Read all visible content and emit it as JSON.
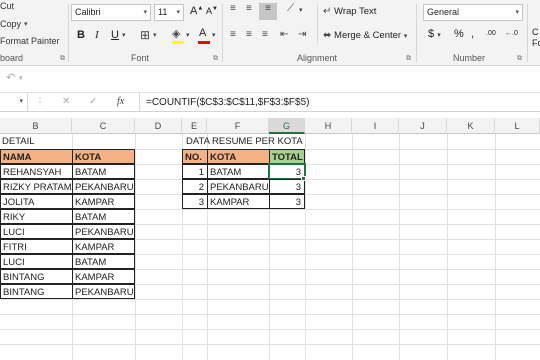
{
  "ribbon": {
    "clipboard": {
      "cut": "Cut",
      "copy": "Copy",
      "format_painter": "Format Painter",
      "label": "board"
    },
    "font": {
      "name": "Calibri",
      "size": "11",
      "grow": "A",
      "shrink": "A",
      "bold": "B",
      "italic": "I",
      "underline": "U",
      "font_color_letter": "A",
      "label": "Font"
    },
    "alignment": {
      "wrap_text": "Wrap Text",
      "merge_center": "Merge & Center",
      "label": "Alignment"
    },
    "number": {
      "format": "General",
      "currency": "$",
      "percent": "%",
      "comma": ",",
      "inc_decimals": ".00",
      "dec_decimals": "←.0",
      "label": "Number"
    },
    "styles": {
      "line1": "C",
      "line2": "Fo"
    }
  },
  "formula_bar": {
    "fx": "fx",
    "cancel": "✕",
    "enter": "✓",
    "formula": "=COUNTIF($C$3:$C$11,$F$3:$F$5)"
  },
  "columns": [
    "B",
    "C",
    "D",
    "E",
    "F",
    "G",
    "H",
    "I",
    "J",
    "K",
    "L"
  ],
  "selected_column": "G",
  "left_table": {
    "title": "DETAIL",
    "headers": [
      "NAMA",
      "KOTA"
    ],
    "rows": [
      [
        "REHANSYAH",
        "BATAM"
      ],
      [
        "RIZKY PRATAMA",
        "PEKANBARU"
      ],
      [
        "JOLITA",
        "KAMPAR"
      ],
      [
        "RIKY",
        "BATAM"
      ],
      [
        "LUCI",
        "PEKANBARU"
      ],
      [
        "FITRI",
        "KAMPAR"
      ],
      [
        "LUCI",
        "BATAM"
      ],
      [
        "BINTANG",
        "KAMPAR"
      ],
      [
        "BINTANG",
        "PEKANBARU"
      ]
    ]
  },
  "right_table": {
    "title": "DATA RESUME PER KOTA",
    "headers": [
      "NO.",
      "KOTA",
      "TOTAL"
    ],
    "rows": [
      [
        "1",
        "BATAM",
        "3"
      ],
      [
        "2",
        "PEKANBARU",
        "3"
      ],
      [
        "3",
        "KAMPAR",
        "3"
      ]
    ]
  },
  "colors": {
    "header_orange": "#f4b183",
    "header_green": "#a9d08e",
    "accent_green": "#217346"
  }
}
